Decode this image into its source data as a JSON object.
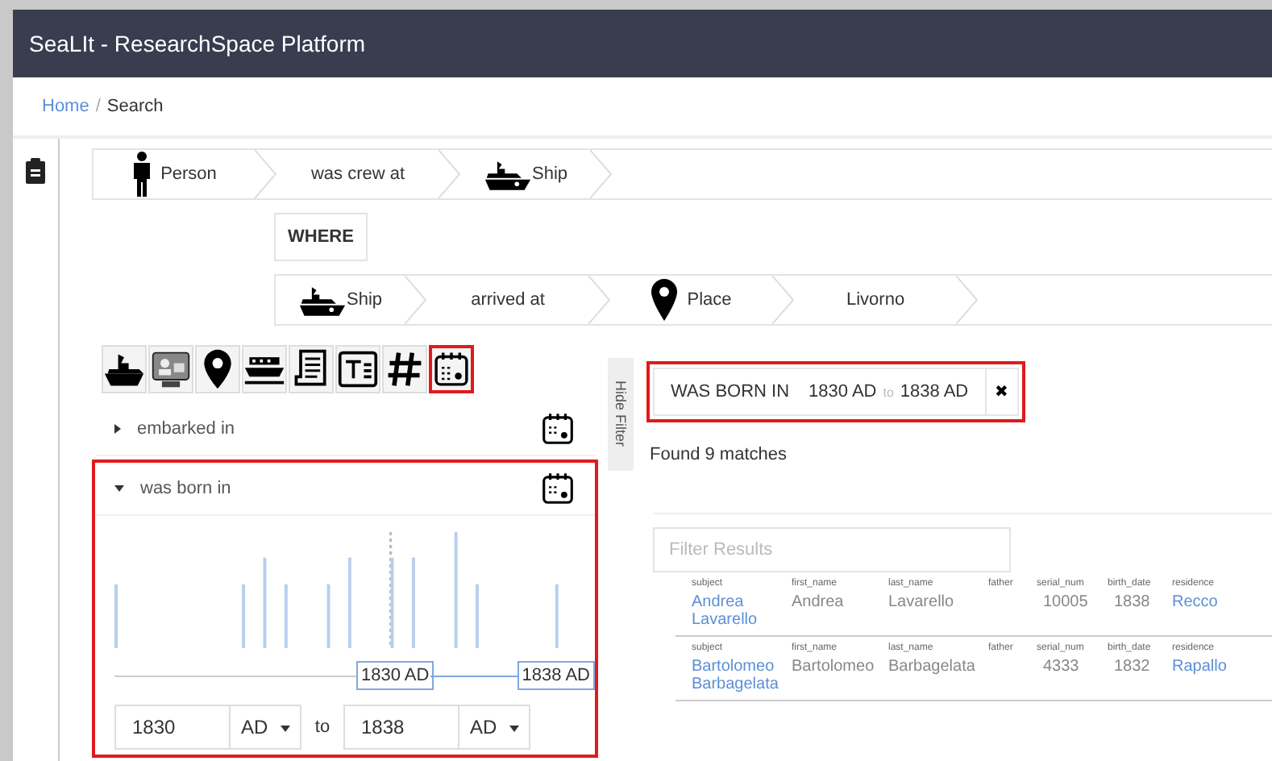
{
  "window": {
    "title": "SeaLIt - ResearchSpace Platform"
  },
  "breadcrumb": [
    {
      "label": "Home",
      "kind": "link"
    },
    {
      "label": "/",
      "kind": "separator"
    },
    {
      "label": "Search",
      "kind": "current"
    }
  ],
  "query": {
    "row_1": [
      {
        "label": "Person",
        "kind": "person"
      },
      {
        "label": "was crew at",
        "kind": "text"
      },
      {
        "label": "Ship",
        "kind": "ship"
      }
    ],
    "where": "WHERE",
    "row_2": [
      {
        "label": "Ship",
        "kind": "ship"
      },
      {
        "label": "arrived at",
        "kind": "text"
      },
      {
        "label": "Place",
        "kind": "place"
      },
      {
        "label": "Livorno",
        "kind": "text"
      }
    ]
  },
  "facet_tabs": [
    {
      "kind": "ship",
      "selected": false
    },
    {
      "kind": "card",
      "selected": false
    },
    {
      "kind": "place",
      "selected": false
    },
    {
      "kind": "ferry",
      "selected": false
    },
    {
      "kind": "document",
      "selected": false
    },
    {
      "kind": "textfield",
      "selected": false
    },
    {
      "kind": "hash",
      "selected": false
    },
    {
      "kind": "calendar",
      "selected": true
    }
  ],
  "facets": [
    {
      "label": "embarked in",
      "expanded": false
    },
    {
      "label": "was born in",
      "expanded": true
    }
  ],
  "range": {
    "from_label": "1830 AD",
    "to_label": "1838 AD",
    "from": "1830",
    "from_era": "AD",
    "separator": "to",
    "to": "1838",
    "to_era": "AD"
  },
  "hide_filter": "Hide Filter",
  "active_filter": {
    "name": "WAS BORN IN",
    "from": "1830 AD",
    "separator": "to",
    "to": "1838 AD",
    "remove": "✖"
  },
  "results_count": "Found 9 matches",
  "filter_field": {
    "placeholder": "Filter Results"
  },
  "results": [
    {
      "cells": [
        {
          "header": "subject",
          "value": "Andrea Lavarello",
          "kind": "link"
        },
        {
          "header": "first_name",
          "value": "Andrea",
          "kind": "text"
        },
        {
          "header": "last_name",
          "value": "Lavarello",
          "kind": "text"
        },
        {
          "header": "father"
        },
        {
          "header": "serial_num",
          "value": "10005",
          "kind": "text"
        },
        {
          "header": "birth_date",
          "value": "1838",
          "kind": "text"
        },
        {
          "header": "residence",
          "value": "Recco",
          "kind": "link"
        }
      ]
    },
    {
      "cells": [
        {
          "header": "subject",
          "value": "Bartolomeo Barbagelata",
          "kind": "link"
        },
        {
          "header": "first_name",
          "value": "Bartolomeo",
          "kind": "text"
        },
        {
          "header": "last_name",
          "value": "Barbagelata",
          "kind": "text"
        },
        {
          "header": "father"
        },
        {
          "header": "serial_num",
          "value": "4333",
          "kind": "text"
        },
        {
          "header": "birth_date",
          "value": "1832",
          "kind": "text"
        },
        {
          "header": "residence",
          "value": "Rapallo",
          "kind": "link"
        }
      ]
    }
  ]
}
